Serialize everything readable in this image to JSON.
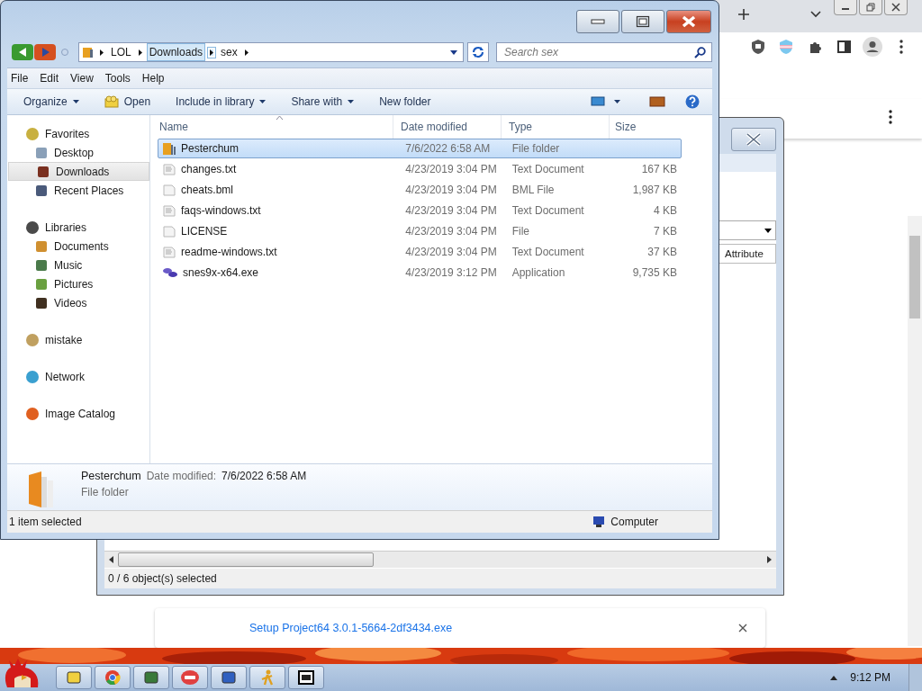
{
  "browser": {
    "download": {
      "filename": "Setup Project64 3.0.1-5664-2df3434.exe"
    }
  },
  "back_window": {
    "column_header": "Attribute",
    "status": "0 / 6 object(s) selected"
  },
  "explorer": {
    "breadcrumb": [
      {
        "label": "LOL",
        "hovered": false
      },
      {
        "label": "Downloads",
        "hovered": true
      },
      {
        "label": "sex",
        "hovered": false
      }
    ],
    "search": {
      "placeholder": "Search sex"
    },
    "menu": [
      "File",
      "Edit",
      "View",
      "Tools",
      "Help"
    ],
    "commands": [
      {
        "label": "Organize",
        "kind": "plain",
        "dropdown": true
      },
      {
        "label": "Open",
        "kind": "open",
        "dropdown": false
      },
      {
        "label": "Include in library",
        "kind": "plain",
        "dropdown": true
      },
      {
        "label": "Share with",
        "kind": "plain",
        "dropdown": true
      },
      {
        "label": "New folder",
        "kind": "plain",
        "dropdown": false
      }
    ],
    "nav": [
      {
        "label": "Favorites",
        "kind": "star",
        "selected": false,
        "children": [
          {
            "label": "Desktop",
            "kind": "desktop",
            "selected": false
          },
          {
            "label": "Downloads",
            "kind": "downloads",
            "selected": true
          },
          {
            "label": "Recent Places",
            "kind": "recent",
            "selected": false
          }
        ]
      },
      {
        "label": "Libraries",
        "kind": "libraries",
        "selected": false,
        "children": [
          {
            "label": "Documents",
            "kind": "documents",
            "selected": false
          },
          {
            "label": "Music",
            "kind": "music",
            "selected": false
          },
          {
            "label": "Pictures",
            "kind": "pictures",
            "selected": false
          },
          {
            "label": "Videos",
            "kind": "videos",
            "selected": false
          }
        ]
      },
      {
        "label": "mistake",
        "kind": "homegroup",
        "selected": false
      },
      {
        "label": "Network",
        "kind": "network",
        "selected": false
      },
      {
        "label": "Image Catalog",
        "kind": "catalog",
        "selected": false
      }
    ],
    "columns": [
      "Name",
      "Date modified",
      "Type",
      "Size"
    ],
    "rows": [
      {
        "name": "Pesterchum",
        "date": "7/6/2022 6:58 AM",
        "type": "File folder",
        "kind": "folder",
        "selected": true
      },
      {
        "name": "changes.txt",
        "date": "4/23/2019 3:04 PM",
        "type": "Text Document",
        "size": "167 KB",
        "kind": "text",
        "selected": false
      },
      {
        "name": "cheats.bml",
        "date": "4/23/2019 3:04 PM",
        "type": "BML File",
        "size": "1,987 KB",
        "kind": "file",
        "selected": false
      },
      {
        "name": "faqs-windows.txt",
        "date": "4/23/2019 3:04 PM",
        "type": "Text Document",
        "size": "4 KB",
        "kind": "text",
        "selected": false
      },
      {
        "name": "LICENSE",
        "date": "4/23/2019 3:04 PM",
        "type": "File",
        "size": "7 KB",
        "kind": "file",
        "selected": false
      },
      {
        "name": "readme-windows.txt",
        "date": "4/23/2019 3:04 PM",
        "type": "Text Document",
        "size": "37 KB",
        "kind": "text",
        "selected": false
      },
      {
        "name": "snes9x-x64.exe",
        "date": "4/23/2019 3:12 PM",
        "type": "Application",
        "size": "9,735 KB",
        "kind": "app",
        "selected": false
      }
    ],
    "details": {
      "name": "Pesterchum",
      "date_label": "Date modified:",
      "date": "7/6/2022 6:58 AM",
      "type": "File folder"
    },
    "status": {
      "text": "1 item selected",
      "location": "Computer"
    }
  },
  "taskbar": {
    "clock": "9:12 PM",
    "apps": [
      {
        "kind": "explorer"
      },
      {
        "kind": "chrome"
      },
      {
        "kind": "monitor"
      },
      {
        "kind": "aim"
      },
      {
        "kind": "notepad"
      },
      {
        "kind": "runner"
      },
      {
        "kind": "archive"
      }
    ]
  }
}
